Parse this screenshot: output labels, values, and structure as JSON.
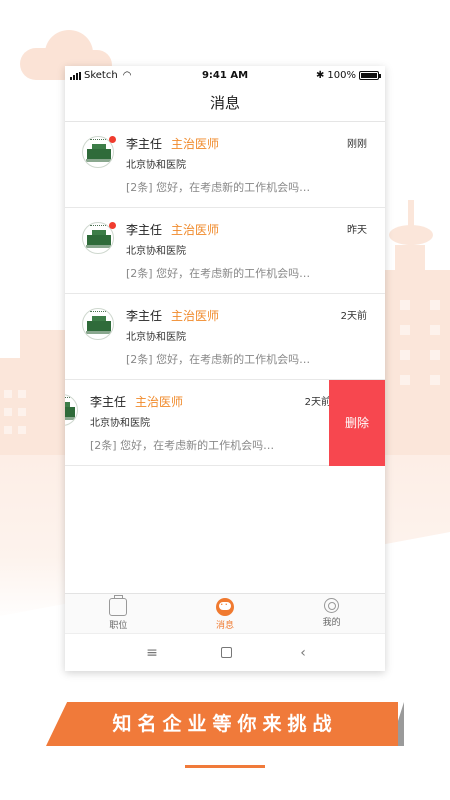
{
  "status_bar": {
    "carrier": "Sketch",
    "time": "9:41 AM",
    "battery": "100%",
    "battery_level": 1.0
  },
  "nav": {
    "title": "消息"
  },
  "messages": [
    {
      "name": "李主任",
      "title": "主治医师",
      "hospital": "北京协和医院",
      "preview": "[2条] 您好，在考虑新的工作机会吗…",
      "time": "刚刚",
      "unread": true
    },
    {
      "name": "李主任",
      "title": "主治医师",
      "hospital": "北京协和医院",
      "preview": "[2条] 您好，在考虑新的工作机会吗…",
      "time": "昨天",
      "unread": true
    },
    {
      "name": "李主任",
      "title": "主治医师",
      "hospital": "北京协和医院",
      "preview": "[2条] 您好，在考虑新的工作机会吗…",
      "time": "2天前",
      "unread": false
    },
    {
      "name": "李主任",
      "title": "主治医师",
      "hospital": "北京协和医院",
      "preview": "[2条] 您好，在考虑新的工作机会吗…",
      "time": "2天前",
      "unread": false,
      "swiped": true,
      "action_label": "删除"
    }
  ],
  "tabs": [
    {
      "label": "职位",
      "icon": "briefcase-icon",
      "active": false
    },
    {
      "label": "消息",
      "icon": "chat-icon",
      "active": true
    },
    {
      "label": "我的",
      "icon": "profile-icon",
      "active": false
    }
  ],
  "system_nav": {
    "menu": "≡",
    "back": "‹"
  },
  "banner": {
    "text": "知名企业等你来挑战"
  },
  "colors": {
    "accent": "#f07a3a",
    "delete": "#f7474f",
    "title_orange": "#f08a2b",
    "unread_dot": "#f03c2e"
  }
}
